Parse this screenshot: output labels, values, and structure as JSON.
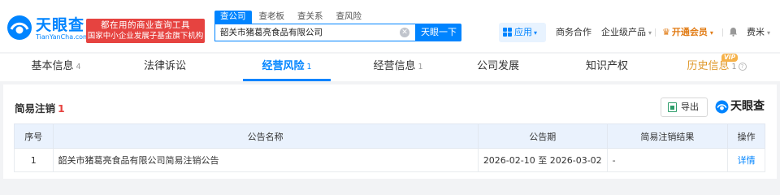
{
  "brand": {
    "logo_text": "天眼查",
    "logo_sub": "TianYanCha.com",
    "slogan_line1": "都在用的商业查询工具",
    "slogan_line2": "国家中小企业发展子基金旗下机构",
    "colors": {
      "primary": "#0084ff",
      "slogan_bg": "#e64340",
      "vip": "#e17b14"
    }
  },
  "search": {
    "tabs": [
      {
        "label": "查公司",
        "active": true
      },
      {
        "label": "查老板",
        "active": false
      },
      {
        "label": "查关系",
        "active": false
      },
      {
        "label": "查风险",
        "active": false
      }
    ],
    "query": "韶关市猪葛亮食品有限公司",
    "button": "天眼一下"
  },
  "nav": {
    "app": "应用",
    "business": "商务合作",
    "enterprise": "企业级产品",
    "vip": "开通会员",
    "user": "费米"
  },
  "tabs": [
    {
      "label": "基本信息",
      "count": "4"
    },
    {
      "label": "法律诉讼",
      "count": ""
    },
    {
      "label": "经营风险",
      "count": "1",
      "active": true
    },
    {
      "label": "经营信息",
      "count": "1"
    },
    {
      "label": "公司发展",
      "count": ""
    },
    {
      "label": "知识产权",
      "count": ""
    },
    {
      "label": "历史信息",
      "count": "1",
      "badge": "VIP",
      "help": "?"
    }
  ],
  "section": {
    "title": "简易注销",
    "count": "1",
    "export": "导出",
    "watermark": "天眼查"
  },
  "table": {
    "headers": [
      "序号",
      "公告名称",
      "公告期",
      "简易注销结果",
      "操作"
    ],
    "rows": [
      {
        "idx": "1",
        "name": "韶关市猪葛亮食品有限公司简易注销公告",
        "period": "2026-02-10 至 2026-03-02",
        "result": "-",
        "action": "详情"
      }
    ]
  }
}
